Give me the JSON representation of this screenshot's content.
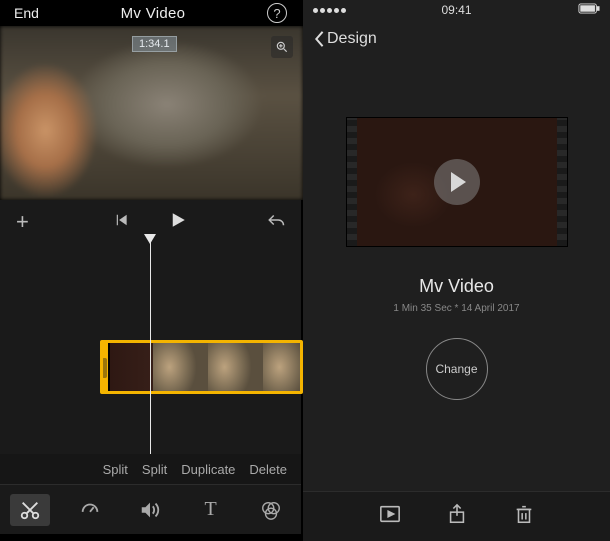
{
  "left": {
    "back_label": "End",
    "title": "Mv Video",
    "preview_timestamp": "1:34.1",
    "context_actions": [
      "Split",
      "Split",
      "Duplicate",
      "Delete"
    ]
  },
  "right": {
    "status": {
      "time": "09:41"
    },
    "back_label": "Design",
    "video_title": "Mv Video",
    "video_meta": "1 Min 35 Sec * 14 April 2017",
    "change_label": "Change"
  }
}
